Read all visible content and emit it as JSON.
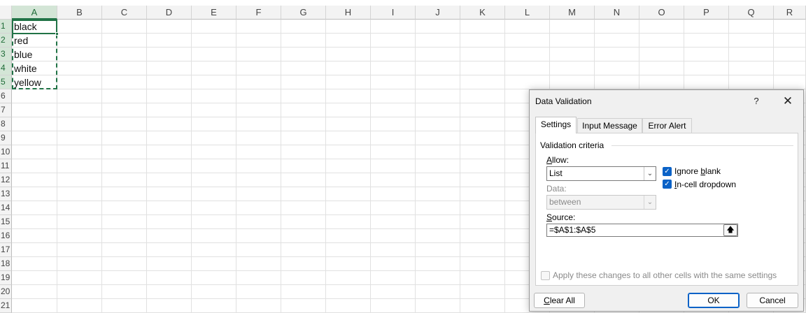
{
  "sheet": {
    "columns": [
      "A",
      "B",
      "C",
      "D",
      "E",
      "F",
      "G",
      "H",
      "I",
      "J",
      "K",
      "L",
      "M",
      "N",
      "O",
      "P",
      "Q",
      "R"
    ],
    "selected_column": "A",
    "rows": [
      "1",
      "2",
      "3",
      "4",
      "5",
      "6",
      "7",
      "8",
      "9",
      "10",
      "11",
      "12",
      "13",
      "14",
      "15",
      "16",
      "17",
      "18",
      "19",
      "20",
      "21"
    ],
    "cells_A": [
      "black",
      "red",
      "blue",
      "white",
      "yellow"
    ]
  },
  "dialog": {
    "title": "Data Validation",
    "help_icon": "?",
    "close_icon": "✕",
    "tabs": [
      "Settings",
      "Input Message",
      "Error Alert"
    ],
    "active_tab": "Settings",
    "group_title": "Validation criteria",
    "allow_label": "Allow:",
    "allow_value": "List",
    "ignore_blank_label": "Ignore blank",
    "ignore_blank_checked": true,
    "in_cell_dropdown_label": "In-cell dropdown",
    "in_cell_dropdown_checked": true,
    "data_label": "Data:",
    "data_value": "between",
    "source_label": "Source:",
    "source_value": "=$A$1:$A$5",
    "apply_all_label": "Apply these changes to all other cells with the same settings",
    "apply_all_checked": false,
    "clear_all_label": "Clear All",
    "ok_label": "OK",
    "cancel_label": "Cancel"
  },
  "colors": {
    "selection_green": "#217346",
    "checkbox_blue": "#0a62c7"
  }
}
